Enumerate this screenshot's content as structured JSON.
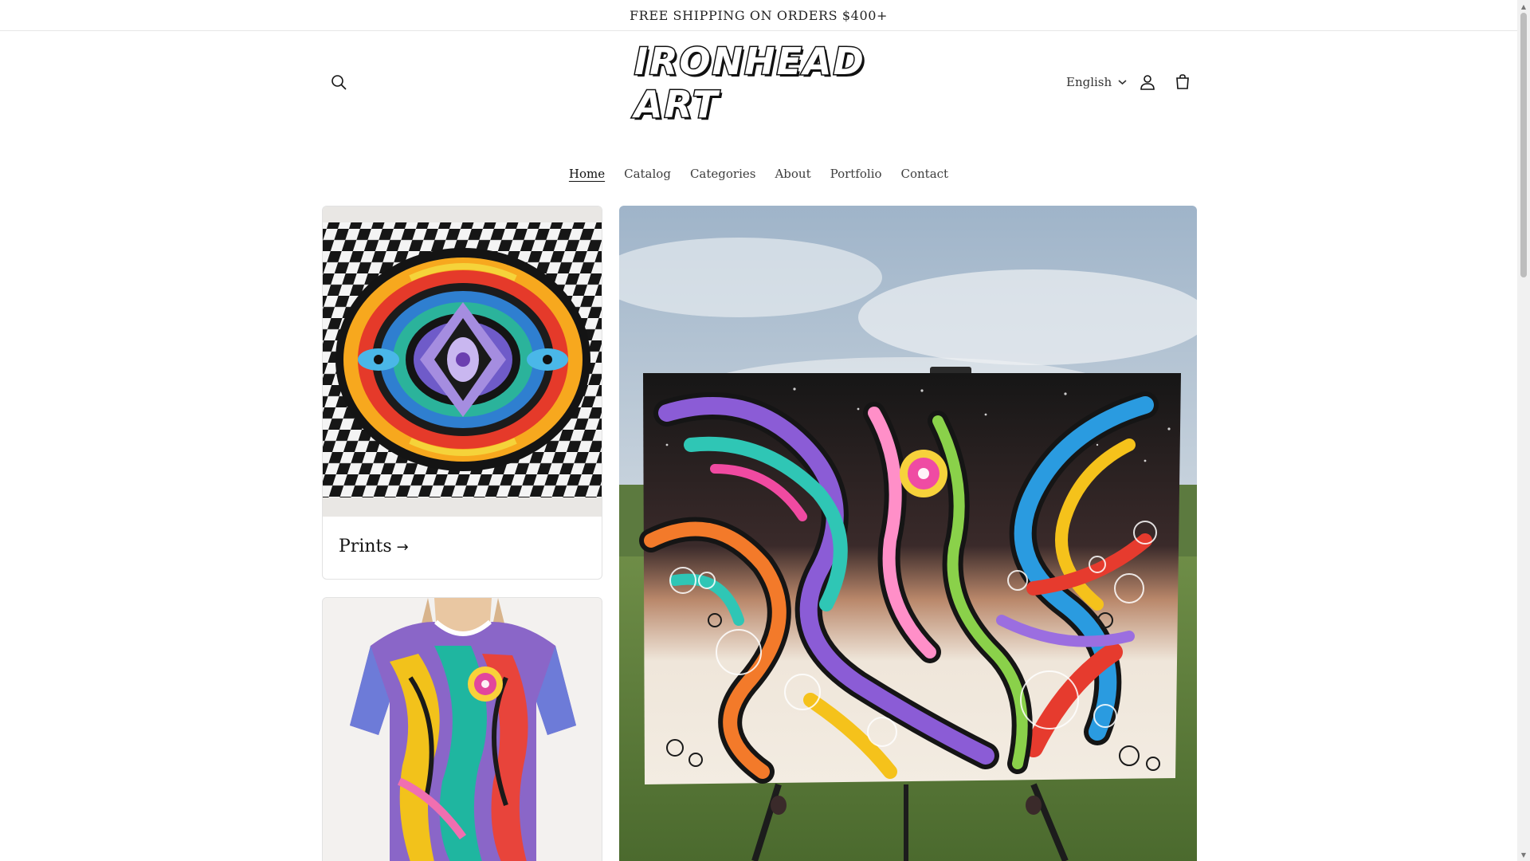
{
  "announcement": {
    "text": "FREE SHIPPING ON ORDERS $400+"
  },
  "header": {
    "logo_text": "IRONHEAD ART",
    "language": "English",
    "icons": {
      "search": "search-icon",
      "account": "account-icon",
      "cart": "cart-icon",
      "language_caret": "chevron-down-icon"
    }
  },
  "nav": {
    "items": [
      {
        "label": "Home",
        "active": true
      },
      {
        "label": "Catalog",
        "active": false
      },
      {
        "label": "Categories",
        "active": false
      },
      {
        "label": "About",
        "active": false
      },
      {
        "label": "Portfolio",
        "active": false
      },
      {
        "label": "Contact",
        "active": false
      }
    ]
  },
  "collections": {
    "prints": {
      "title": "Prints",
      "arrow": "→"
    }
  },
  "colors": {
    "text": "#121212",
    "border": "#e2e2e2",
    "announcement_border": "#e6e6e6"
  }
}
